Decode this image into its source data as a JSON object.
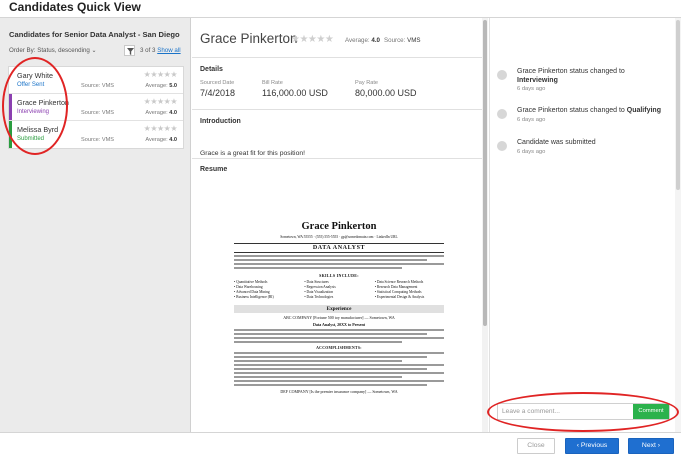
{
  "window": {
    "title": "Candidates Quick View"
  },
  "sidebar": {
    "title": "Candidates for Senior Data Analyst - San Diego",
    "order_by": "Order By:  Status, descending ⌄",
    "count_text": "3 of 3",
    "show_all": "Show all",
    "candidates": [
      {
        "name": "Gary White",
        "status": "Offer Sent",
        "status_color": "#1a73c8",
        "source": "Source: VMS",
        "stars": "★★★★★",
        "average_label": "Average:",
        "average": "5.0",
        "bar_color": "#ffffff"
      },
      {
        "name": "Grace Pinkerton",
        "status": "Interviewing",
        "status_color": "#8b3fb0",
        "source": "Source: VMS",
        "stars": "★★★★★",
        "average_label": "Average:",
        "average": "4.0",
        "bar_color": "#8b3fb0"
      },
      {
        "name": "Melissa Byrd",
        "status": "Submitted",
        "status_color": "#2a9d3f",
        "source": "Source: VMS",
        "stars": "★★★★★",
        "average_label": "Average:",
        "average": "4.0",
        "bar_color": "#2a9d3f"
      }
    ]
  },
  "detail": {
    "name": "Grace Pinkerton",
    "stars": "★★★★★",
    "average_label": "Average:",
    "average": "4.0",
    "source_label": "Source:",
    "source": "VMS",
    "details_title": "Details",
    "sourced_label": "Sourced Date",
    "sourced_value": "7/4/2018",
    "bill_label": "Bill Rate",
    "bill_value": "116,000.00 USD",
    "pay_label": "Pay Rate",
    "pay_value": "80,000.00 USD",
    "intro_title": "Introduction",
    "intro_text": "Grace is a great fit for this position!",
    "resume_title": "Resume"
  },
  "resume": {
    "name": "Grace Pinkerton",
    "contact": "Sometown, WA 55555 · (555) 555-5555 · gp@somedomain.com · LinkedIn URL",
    "role": "DATA ANALYST",
    "skills_heading": "SKILLS INCLUDE:",
    "skills_col1": [
      "Quantitative Methods",
      "Data Warehousing",
      "Advanced Data Mining",
      "Business Intelligence (BI)"
    ],
    "skills_col2": [
      "Data Structures",
      "Regression Analysis",
      "Data Visualization",
      "Data Technologies"
    ],
    "skills_col3": [
      "Data Science Research Methods",
      "Research Data Management",
      "Statistical Computing Methods",
      "Experimental Design & Analysis"
    ],
    "experience_heading": "Experience",
    "company": "ABC COMPANY  [Fortune 500 toy manufacturer]  —  Sometown, WA",
    "position": "Data Analyst, 20XX to Present",
    "accomplishments_heading": "ACCOMPLISHMENTS:",
    "company2": "DEF COMPANY  [Is the premier insurance company]  —  Sometown, WA"
  },
  "activity": [
    {
      "prefix": "Grace Pinkerton",
      "middle": " status changed to ",
      "bold": "Interviewing",
      "ago": "6 days ago"
    },
    {
      "prefix": "Grace Pinkerton",
      "middle": " status changed to ",
      "bold": "Qualifying",
      "ago": "6 days ago"
    },
    {
      "prefix": "",
      "middle": "Candidate was submitted",
      "bold": "",
      "ago": "6 days ago"
    }
  ],
  "comment": {
    "placeholder": "Leave a comment...",
    "button": "Comment"
  },
  "footer": {
    "close": "Close",
    "previous": "‹  Previous",
    "next": "Next  ›"
  }
}
